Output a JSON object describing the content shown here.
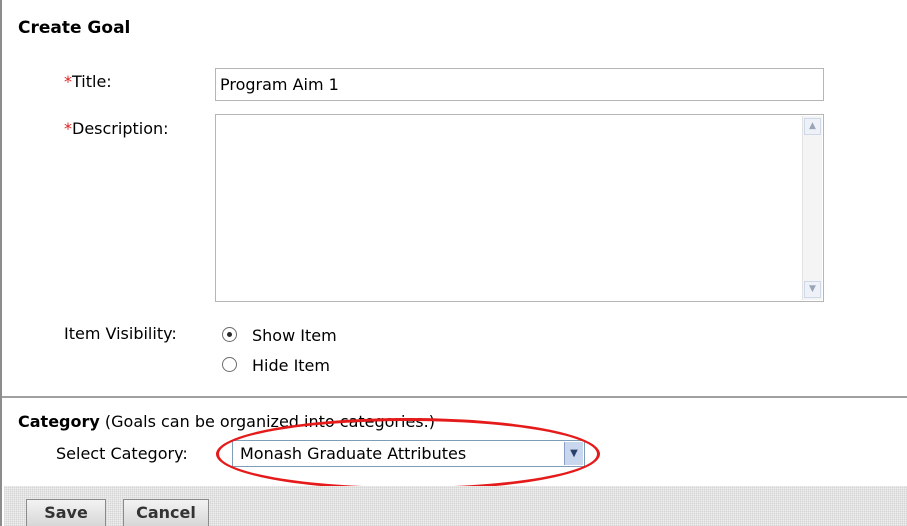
{
  "form": {
    "heading": "Create Goal",
    "required_marker": "*",
    "title_label": "Title:",
    "title_value": "Program Aim 1",
    "description_label": "Description:",
    "description_value": "",
    "visibility_label": "Item Visibility:",
    "visibility_options": [
      {
        "label": "Show Item",
        "selected": true
      },
      {
        "label": "Hide Item",
        "selected": false
      }
    ]
  },
  "category": {
    "heading": "Category",
    "hint": " (Goals can be organized into categories.)",
    "select_label": "Select Category:",
    "selected_value": "Monash Graduate Attributes"
  },
  "buttons": {
    "save": "Save",
    "cancel": "Cancel"
  },
  "colors": {
    "required": "#e02020",
    "annotation": "#e51b1b"
  },
  "icons": {
    "scroll_up": "scroll-up-arrow-icon",
    "scroll_down": "scroll-down-arrow-icon",
    "dropdown": "chevron-down-icon"
  }
}
